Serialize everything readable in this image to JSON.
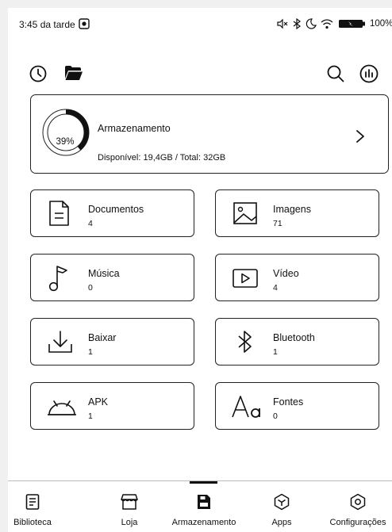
{
  "status_bar": {
    "time": "3:45 da tarde",
    "battery_percent": "100%"
  },
  "storage": {
    "used_percent_label": "39%",
    "used_fraction": 0.39,
    "title": "Armazenamento",
    "detail": "Disponível: 19,4GB / Total: 32GB"
  },
  "categories": [
    {
      "name": "Documentos",
      "count": "4",
      "icon": "document-icon"
    },
    {
      "name": "Imagens",
      "count": "71",
      "icon": "image-icon"
    },
    {
      "name": "Música",
      "count": "0",
      "icon": "music-icon"
    },
    {
      "name": "Vídeo",
      "count": "4",
      "icon": "video-icon"
    },
    {
      "name": "Baixar",
      "count": "1",
      "icon": "download-icon"
    },
    {
      "name": "Bluetooth",
      "count": "1",
      "icon": "bluetooth-icon"
    },
    {
      "name": "APK",
      "count": "1",
      "icon": "android-icon"
    },
    {
      "name": "Fontes",
      "count": "0",
      "icon": "font-icon"
    }
  ],
  "bottom_nav": [
    {
      "label": "Biblioteca",
      "icon": "library-icon"
    },
    {
      "label": "Loja",
      "icon": "store-icon"
    },
    {
      "label": "Armazenamento",
      "icon": "storage-icon",
      "active": true
    },
    {
      "label": "Apps",
      "icon": "apps-icon"
    },
    {
      "label": "Configurações",
      "icon": "settings-icon"
    }
  ]
}
